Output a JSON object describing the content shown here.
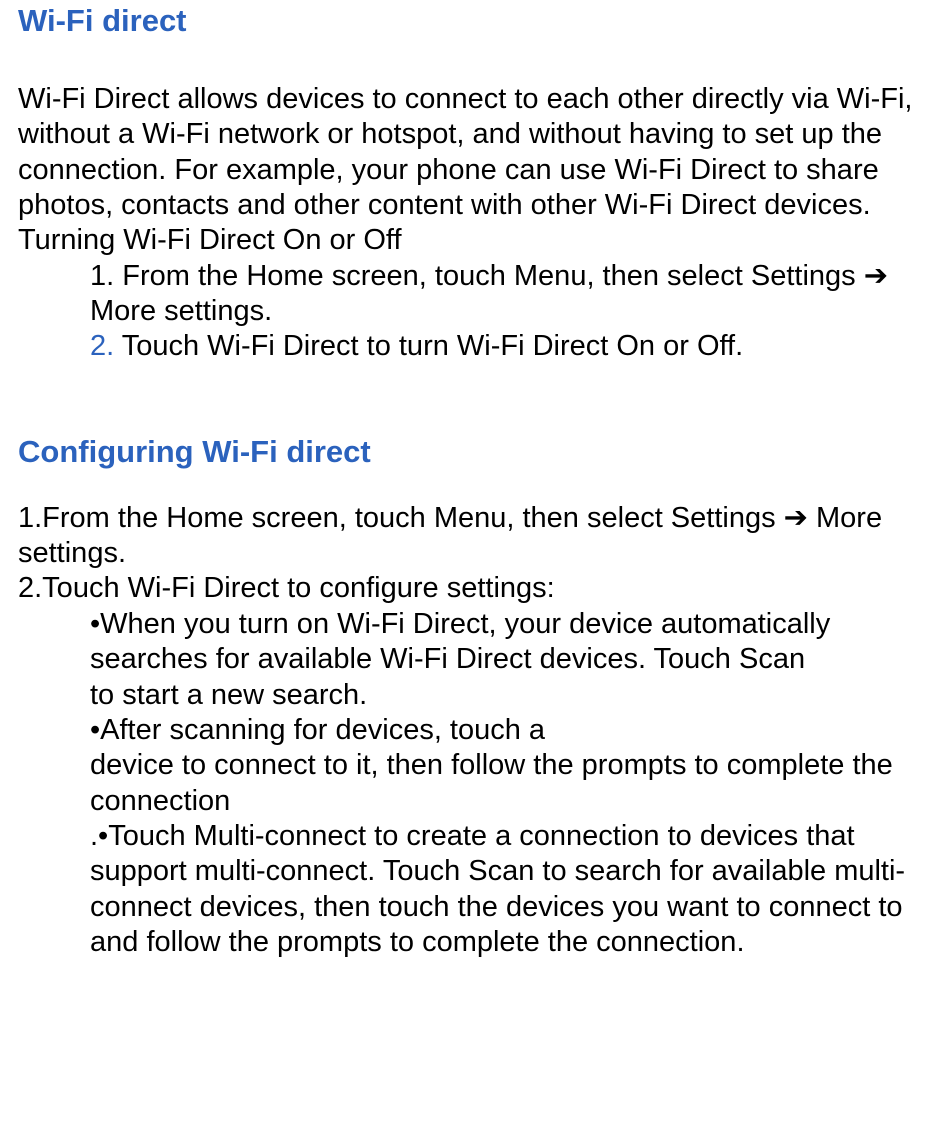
{
  "section1": {
    "heading": "Wi-Fi direct",
    "intro": "Wi-Fi Direct allows devices to connect to each other directly via Wi-Fi, without a Wi-Fi network or hotspot, and without having to set up the connection. For example, your phone can use Wi-Fi Direct to share photos, contacts and other content with other Wi-Fi Direct devices.",
    "subhead": "Turning Wi-Fi Direct On or Off",
    "step1_pre": "1. From the Home screen, touch Menu, then select Settings  ",
    "step1_arrow": "➔",
    "step1_post": "  More settings.",
    "step2_num": "2.",
    "step2_text": " Touch Wi-Fi Direct    to turn Wi-Fi Direct On or Off."
  },
  "section2": {
    "heading": "Configuring Wi-Fi direct",
    "step1_pre": "1.From the Home screen, touch    Menu, then select Settings  ",
    "step1_arrow": "➔",
    "step1_post": "  More settings.",
    "step2": "2.Touch Wi-Fi Direct to configure settings:",
    "bullet1_l1": "•When you turn on Wi-Fi Direct, your device automatically",
    "bullet1_l2": "  searches for available Wi-Fi Direct devices. Touch Scan",
    "bullet1_l3": "to start a new search.",
    "bullet2": "•After scanning for devices, touch a",
    "bullet2b": "device to connect to it, then follow the prompts to complete the connection",
    "bullet3": ".•Touch Multi-connect to create a connection to devices that support multi-connect. Touch Scan to search for available multi-connect devices, then touch the devices you want to connect to and follow the prompts to complete the connection."
  }
}
